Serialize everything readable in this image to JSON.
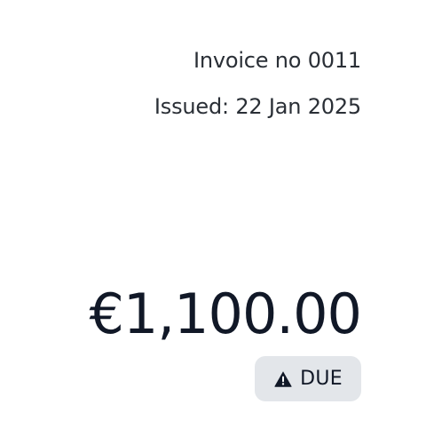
{
  "invoice": {
    "number_label": "Invoice no 0011",
    "issued_label": "Issued: 22 Jan 2025",
    "amount": "€1,100.00",
    "status": {
      "label": "DUE",
      "icon": "warning-icon",
      "badge_color": "#e3e6ea"
    }
  }
}
